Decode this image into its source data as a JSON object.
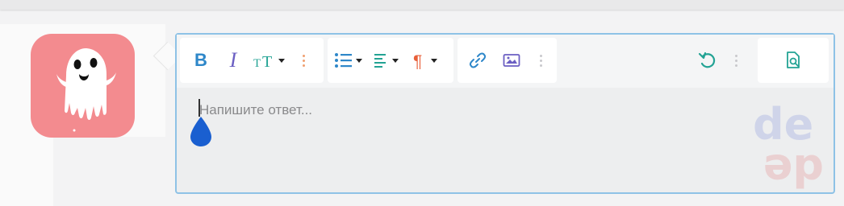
{
  "toolbar": {
    "format_group": {
      "bold_label": "B",
      "italic_label": "I",
      "text_size_icon": "text-size-icon",
      "more_icon": "kebab-menu-icon"
    },
    "list_group": {
      "list_icon": "bulleted-list-icon",
      "align_icon": "align-left-icon",
      "paragraph_icon": "paragraph-icon"
    },
    "insert_group": {
      "link_icon": "link-icon",
      "image_icon": "image-icon",
      "more_icon": "kebab-menu-icon"
    },
    "history_group": {
      "undo_icon": "undo-icon",
      "more_icon": "kebab-menu-icon"
    },
    "preview_icon": "preview-document-icon"
  },
  "editor": {
    "placeholder": "Напишите ответ..."
  },
  "avatar": {
    "icon": "ghost-icon"
  },
  "colors": {
    "blue": "#2e87c9",
    "purple": "#6b5fc3",
    "teal": "#23a394",
    "orange": "#f0a070",
    "red": "#e8603a",
    "avatar_bg": "#f38b8f",
    "border": "#8ec2e6"
  }
}
